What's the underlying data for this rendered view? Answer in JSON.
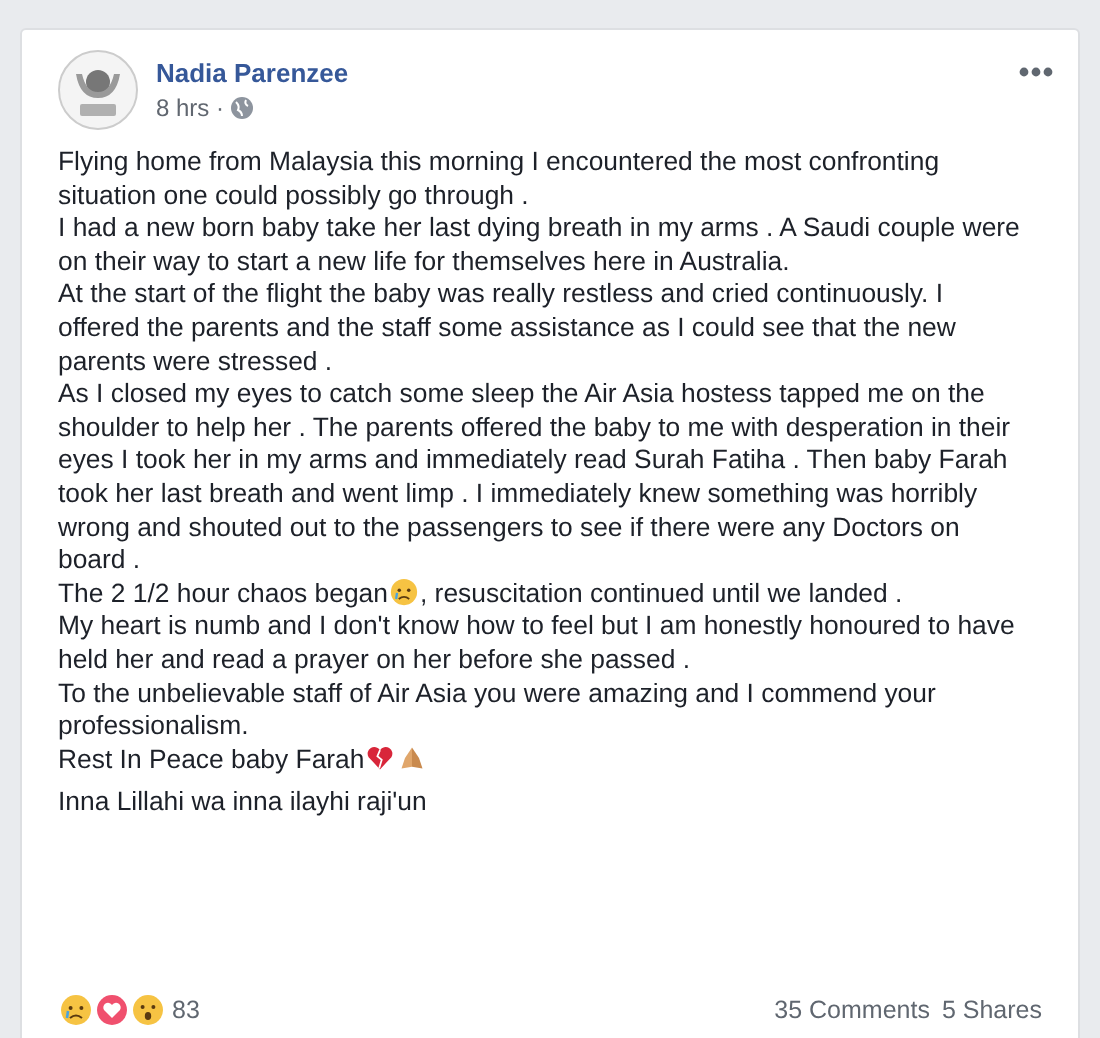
{
  "post": {
    "author": "Nadia Parenzee",
    "time": "8 hrs ·",
    "paragraphs": [
      {
        "segments": [
          {
            "kind": "text",
            "text": "Flying home from Malaysia this morning I encountered the most confronting situation one could possibly go through ."
          }
        ]
      },
      {
        "segments": [
          {
            "kind": "text",
            "text": "I had a new born baby take her last dying breath in my arms . A Saudi couple were on their way to start a new life for themselves here in Australia."
          }
        ]
      },
      {
        "segments": [
          {
            "kind": "text",
            "text": "At the start of the flight the baby was really restless and cried continuously. I offered the parents and the staff some assistance as I could see that the new parents were stressed ."
          }
        ]
      },
      {
        "segments": [
          {
            "kind": "text",
            "text": "As I closed my eyes to catch some sleep the Air Asia hostess tapped me on the shoulder to help her . The parents offered the baby to me with desperation in their eyes I took her in my arms and immediately read Surah Fatiha . Then baby Farah took her last breath and went limp . I immediately knew something was horribly wrong and shouted out to the passengers to see if there were any Doctors on board ."
          }
        ]
      },
      {
        "segments": [
          {
            "kind": "text",
            "text": "The 2 1/2 hour chaos began"
          },
          {
            "kind": "crying"
          },
          {
            "kind": "text",
            "text": ", resuscitation continued until we landed ."
          }
        ]
      },
      {
        "segments": [
          {
            "kind": "text",
            "text": "My heart is numb and I don't know how to feel but I am honestly honoured to have held her and read a prayer on her before she passed ."
          }
        ]
      },
      {
        "segments": [
          {
            "kind": "text",
            "text": "To the unbelievable staff of Air Asia you were amazing and I commend your professionalism."
          }
        ]
      },
      {
        "segments": [
          {
            "kind": "text",
            "text": "Rest In Peace baby Farah"
          },
          {
            "kind": "heartbreak"
          },
          {
            "kind": "hands"
          }
        ]
      },
      {
        "segments": [
          {
            "kind": "text",
            "text": "Inna Lillahi wa inna ilayhi raji'un"
          }
        ]
      }
    ],
    "reaction_count": "83",
    "comments": "35 Comments",
    "shares": "5 Shares"
  }
}
